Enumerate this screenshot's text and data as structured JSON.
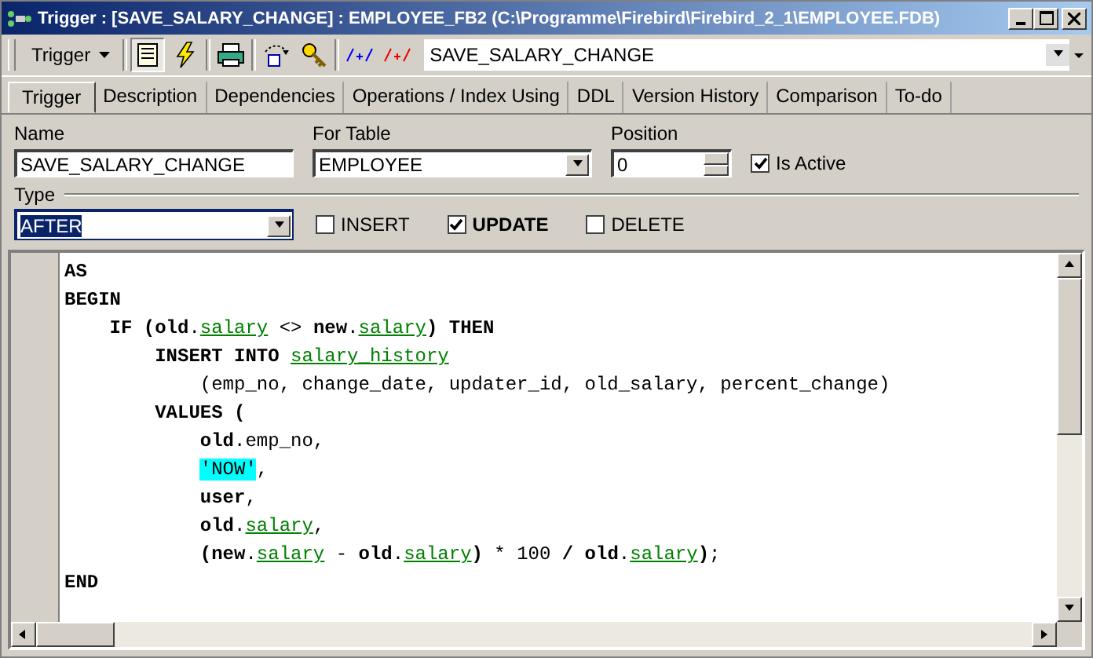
{
  "window": {
    "title": "Trigger : [SAVE_SALARY_CHANGE] : EMPLOYEE_FB2 (C:\\Programme\\Firebird\\Firebird_2_1\\EMPLOYEE.FDB)"
  },
  "toolbar": {
    "menu_label": "Trigger",
    "object_selector": "SAVE_SALARY_CHANGE"
  },
  "tabs": [
    {
      "label": "Trigger",
      "selected": true
    },
    {
      "label": "Description",
      "selected": false
    },
    {
      "label": "Dependencies",
      "selected": false
    },
    {
      "label": "Operations / Index Using",
      "selected": false
    },
    {
      "label": "DDL",
      "selected": false
    },
    {
      "label": "Version History",
      "selected": false
    },
    {
      "label": "Comparison",
      "selected": false
    },
    {
      "label": "To-do",
      "selected": false
    }
  ],
  "form": {
    "name_label": "Name",
    "name_value": "SAVE_SALARY_CHANGE",
    "table_label": "For Table",
    "table_value": "EMPLOYEE",
    "position_label": "Position",
    "position_value": "0",
    "active_label": "Is Active",
    "active_checked": true,
    "type_label": "Type",
    "type_value": "AFTER",
    "events": [
      {
        "label": "INSERT",
        "checked": false
      },
      {
        "label": "UPDATE",
        "checked": true
      },
      {
        "label": "DELETE",
        "checked": false
      }
    ]
  },
  "code": [
    {
      "tokens": [
        {
          "kind": "keyword",
          "text": "AS"
        }
      ]
    },
    {
      "tokens": [
        {
          "kind": "keyword",
          "text": "BEGIN"
        }
      ],
      "children": [
        {
          "tokens": [
            {
              "kind": "keyword",
              "text": "IF ("
            },
            {
              "kind": "keyword",
              "text": "old"
            },
            {
              "kind": "plain",
              "text": "."
            },
            {
              "kind": "ident",
              "text": "salary"
            },
            {
              "kind": "plain",
              "text": " <> "
            },
            {
              "kind": "keyword",
              "text": "new"
            },
            {
              "kind": "plain",
              "text": "."
            },
            {
              "kind": "ident",
              "text": "salary"
            },
            {
              "kind": "keyword",
              "text": ") THEN"
            }
          ],
          "children": [
            {
              "tokens": [
                {
                  "kind": "keyword",
                  "text": "INSERT INTO "
                },
                {
                  "kind": "ident",
                  "text": "salary_history"
                }
              ],
              "children": [
                {
                  "tokens": [
                    {
                      "kind": "plain",
                      "text": "(emp_no, change_date, updater_id, old_salary, percent_change)"
                    }
                  ]
                }
              ]
            },
            {
              "tokens": [
                {
                  "kind": "keyword",
                  "text": "VALUES ("
                }
              ],
              "children": [
                {
                  "tokens": [
                    {
                      "kind": "keyword",
                      "text": "old"
                    },
                    {
                      "kind": "plain",
                      "text": ".emp_no,"
                    }
                  ]
                },
                {
                  "tokens": [
                    {
                      "kind": "string",
                      "text": "'NOW'"
                    },
                    {
                      "kind": "plain",
                      "text": ","
                    }
                  ]
                },
                {
                  "tokens": [
                    {
                      "kind": "keyword",
                      "text": "user"
                    },
                    {
                      "kind": "plain",
                      "text": ","
                    }
                  ]
                },
                {
                  "tokens": [
                    {
                      "kind": "keyword",
                      "text": "old"
                    },
                    {
                      "kind": "plain",
                      "text": "."
                    },
                    {
                      "kind": "ident",
                      "text": "salary"
                    },
                    {
                      "kind": "plain",
                      "text": ","
                    }
                  ]
                },
                {
                  "tokens": [
                    {
                      "kind": "keyword",
                      "text": "(new"
                    },
                    {
                      "kind": "plain",
                      "text": "."
                    },
                    {
                      "kind": "ident",
                      "text": "salary"
                    },
                    {
                      "kind": "plain",
                      "text": " - "
                    },
                    {
                      "kind": "keyword",
                      "text": "old"
                    },
                    {
                      "kind": "plain",
                      "text": "."
                    },
                    {
                      "kind": "ident",
                      "text": "salary"
                    },
                    {
                      "kind": "keyword",
                      "text": ")"
                    },
                    {
                      "kind": "plain",
                      "text": " * 100 "
                    },
                    {
                      "kind": "keyword",
                      "text": "/ old"
                    },
                    {
                      "kind": "plain",
                      "text": "."
                    },
                    {
                      "kind": "ident",
                      "text": "salary"
                    },
                    {
                      "kind": "keyword",
                      "text": ")"
                    },
                    {
                      "kind": "plain",
                      "text": ";"
                    }
                  ]
                }
              ]
            }
          ]
        }
      ]
    },
    {
      "tokens": [
        {
          "kind": "keyword",
          "text": "END"
        }
      ]
    }
  ]
}
